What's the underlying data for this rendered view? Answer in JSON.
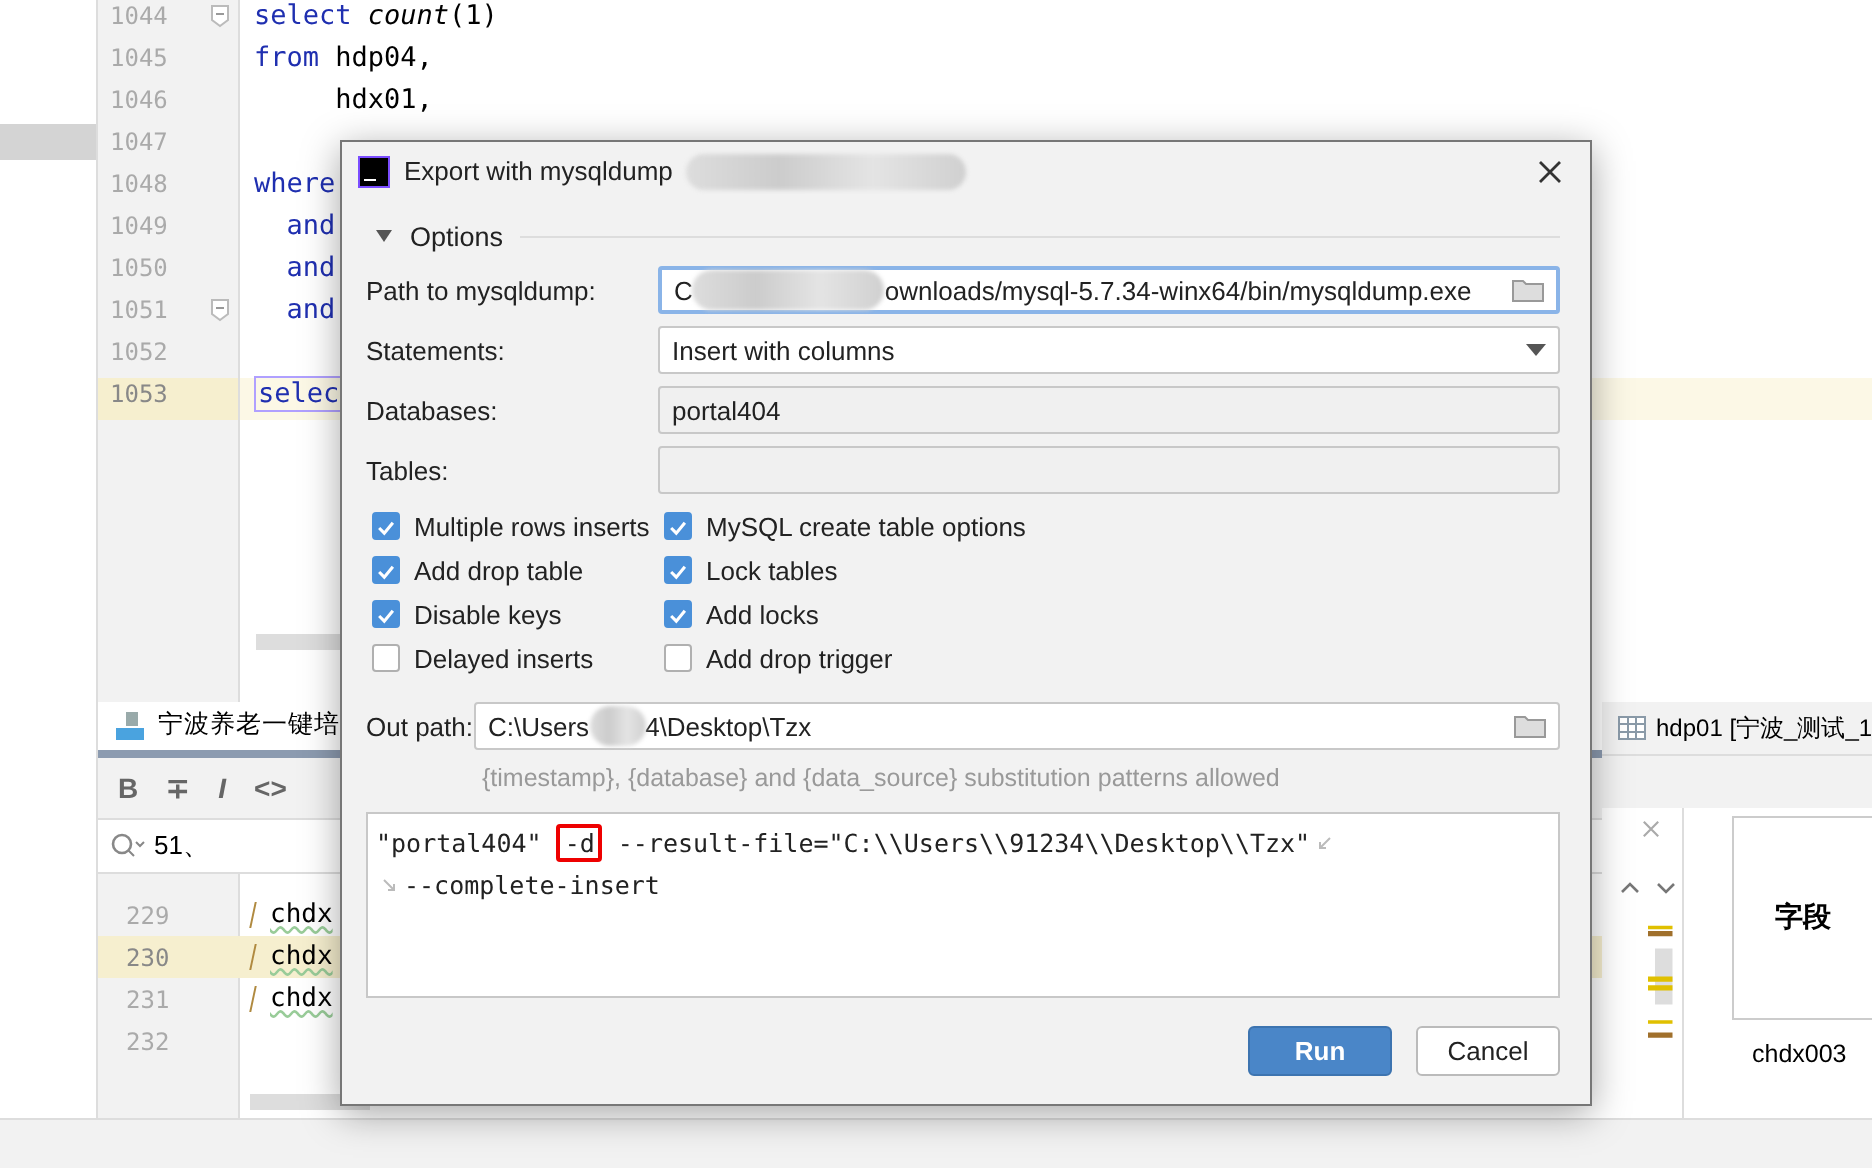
{
  "editor": {
    "lines": [
      {
        "number": "1044",
        "current": false,
        "fold": true,
        "tokens": [
          {
            "text": "select",
            "kind": "keyword"
          },
          {
            "text": "count",
            "kind": "function"
          },
          {
            "text": "(1)",
            "kind": "plain"
          }
        ]
      },
      {
        "number": "1045",
        "current": false,
        "fold": false,
        "tokens": [
          {
            "text": "from",
            "kind": "keyword"
          },
          {
            "text": " hdp04,",
            "kind": "plain"
          }
        ]
      },
      {
        "number": "1046",
        "current": false,
        "fold": false,
        "tokens": [
          {
            "text": "     hdx01,",
            "kind": "plain"
          }
        ]
      },
      {
        "number": "1047",
        "current": false,
        "fold": false
      },
      {
        "number": "1048",
        "current": false,
        "fold": false,
        "tokens": [
          {
            "text": "where",
            "kind": "keyword"
          }
        ]
      },
      {
        "number": "1049",
        "current": false,
        "fold": false,
        "tokens": [
          {
            "text": "  and",
            "kind": "keyword"
          }
        ]
      },
      {
        "number": "1050",
        "current": false,
        "fold": false,
        "tokens": [
          {
            "text": "  and",
            "kind": "keyword"
          }
        ]
      },
      {
        "number": "1051",
        "current": false,
        "fold": true,
        "tokens": [
          {
            "text": "  and",
            "kind": "keyword"
          }
        ]
      },
      {
        "number": "1052",
        "current": false,
        "fold": false
      },
      {
        "number": "1053",
        "current": true,
        "fold": false,
        "tokens": [
          {
            "text": "selec",
            "kind": "boxed"
          }
        ]
      }
    ]
  },
  "bottom_panel": {
    "tab": "宁波养老一键培",
    "toolbar": [
      "B",
      "∓",
      "I",
      "<>"
    ],
    "search": {
      "value": "51、"
    },
    "lines": [
      {
        "number": "229",
        "current": false,
        "text": "chdx"
      },
      {
        "number": "230",
        "current": true,
        "text": "chdx"
      },
      {
        "number": "231",
        "current": false,
        "text": "chdx"
      },
      {
        "number": "232",
        "current": false
      }
    ]
  },
  "right_panel": {
    "tab": "hdp01 [宁波_测试_1",
    "table": {
      "header": "字段",
      "cell": "chdx003"
    }
  },
  "dialog": {
    "title": "Export with mysqldump",
    "section": {
      "label": "Options",
      "expanded": true
    },
    "fields": [
      {
        "label": "Path to mysqldump:",
        "kind": "path",
        "before": "C",
        "after": "ownloads/mysql-5.7.34-winx64/bin/mysqldump.exe",
        "focused": true
      },
      {
        "label": "Statements:",
        "kind": "dropdown",
        "value": "Insert with columns"
      },
      {
        "label": "Databases:",
        "kind": "readonly",
        "value": "portal404"
      },
      {
        "label": "Tables:",
        "kind": "readonly"
      }
    ],
    "options": [
      {
        "label": "Multiple rows inserts",
        "checked": true
      },
      {
        "label": "MySQL create table options",
        "checked": true
      },
      {
        "label": "Add drop table",
        "checked": true
      },
      {
        "label": "Lock tables",
        "checked": true
      },
      {
        "label": "Disable keys",
        "checked": true
      },
      {
        "label": "Add locks",
        "checked": true
      },
      {
        "label": "Delayed inserts",
        "checked": false
      },
      {
        "label": "Add drop trigger",
        "checked": false
      }
    ],
    "out_path": {
      "label": "Out path:",
      "before": "C:\\Users",
      "after": "4\\Desktop\\Tzx"
    },
    "hint": "{timestamp}, {database} and {data_source} substitution patterns allowed",
    "command": [
      [
        {
          "text": "\"portal404\" ",
          "highlighted": false
        },
        {
          "text": "-d",
          "highlighted": true
        },
        {
          "text": " --result-file=\"C:\\\\Users\\\\91234\\\\Desktop\\\\Tzx\"",
          "highlighted": false
        }
      ],
      [
        {
          "text": "--complete-insert",
          "highlighted": false
        }
      ]
    ],
    "buttons": [
      {
        "label": "Run",
        "primary": true
      },
      {
        "label": "Cancel",
        "primary": false
      }
    ]
  }
}
